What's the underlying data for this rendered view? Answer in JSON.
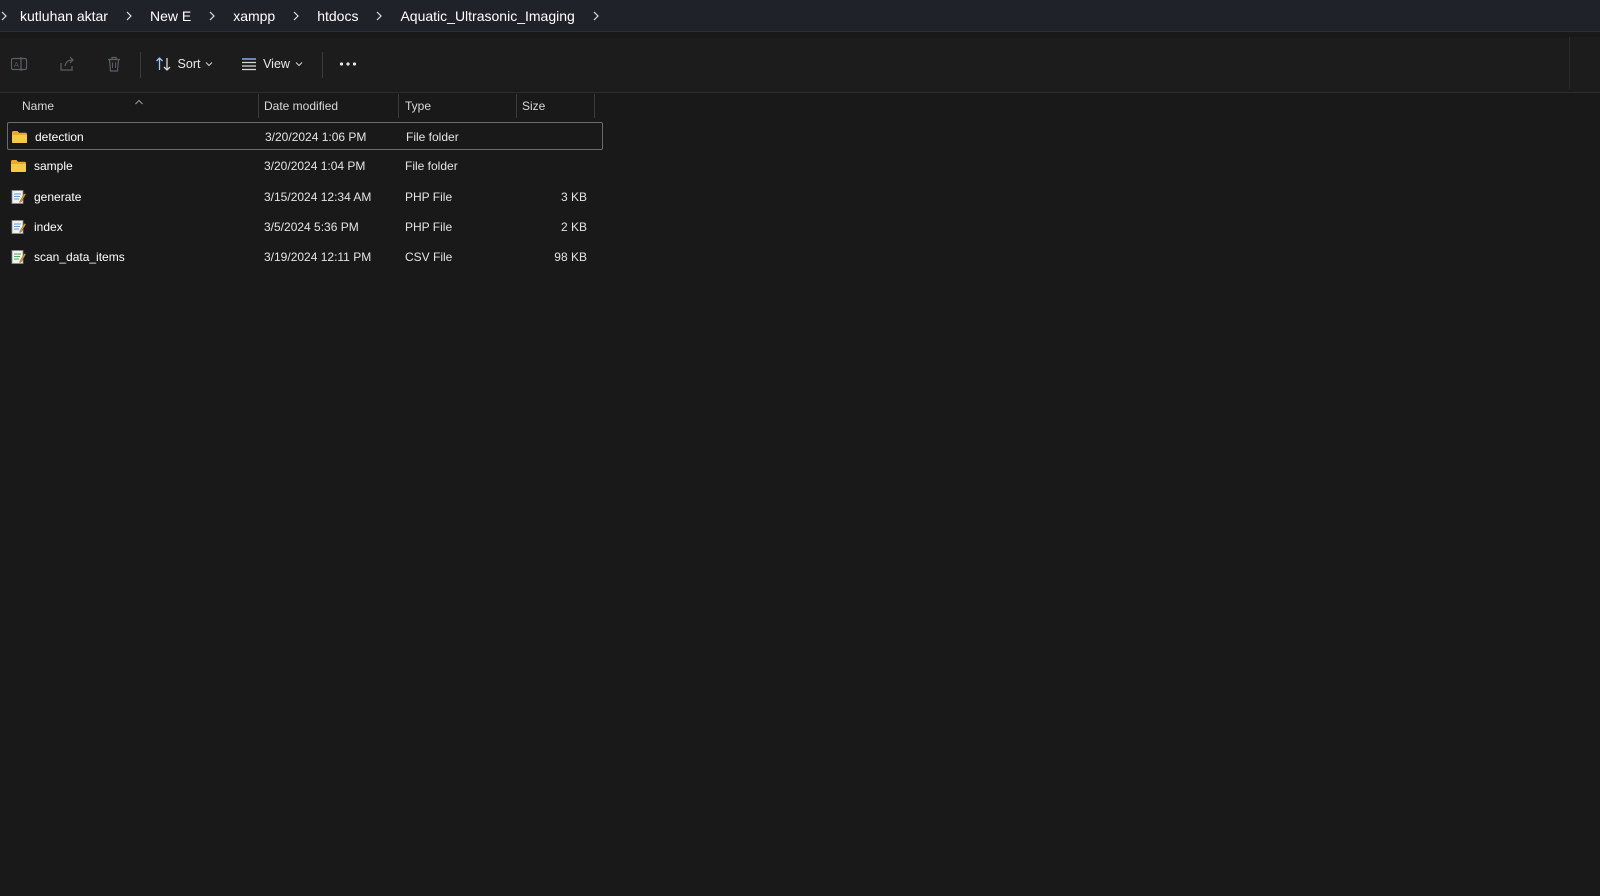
{
  "breadcrumb": {
    "items": [
      {
        "label": "kutluhan aktar"
      },
      {
        "label": "New E"
      },
      {
        "label": "xampp"
      },
      {
        "label": "htdocs"
      },
      {
        "label": "Aquatic_Ultrasonic_Imaging"
      }
    ]
  },
  "toolbar": {
    "rename_icon": "rename-icon",
    "share_icon": "share-icon",
    "delete_icon": "trash-icon",
    "sort_label": "Sort",
    "view_label": "View",
    "more_icon": "more-icon"
  },
  "columns": {
    "name": "Name",
    "date_modified": "Date modified",
    "type": "Type",
    "size": "Size",
    "sorted_by": "name-ascending"
  },
  "files": [
    {
      "name": "detection",
      "date": "3/20/2024 1:06 PM",
      "type": "File folder",
      "size": "",
      "icon": "folder-icon",
      "selected": true
    },
    {
      "name": "sample",
      "date": "3/20/2024 1:04 PM",
      "type": "File folder",
      "size": "",
      "icon": "folder-icon",
      "selected": false
    },
    {
      "name": "generate",
      "date": "3/15/2024 12:34 AM",
      "type": "PHP File",
      "size": "3 KB",
      "icon": "php-file-icon",
      "selected": false
    },
    {
      "name": "index",
      "date": "3/5/2024 5:36 PM",
      "type": "PHP File",
      "size": "2 KB",
      "icon": "php-file-icon",
      "selected": false
    },
    {
      "name": "scan_data_items",
      "date": "3/19/2024 12:11 PM",
      "type": "CSV File",
      "size": "98 KB",
      "icon": "csv-file-icon",
      "selected": false
    }
  ],
  "colors": {
    "background": "#191919",
    "address_bar": "#1f2229",
    "folder": "#f5c242",
    "selection_border": "#6b6b6b"
  }
}
